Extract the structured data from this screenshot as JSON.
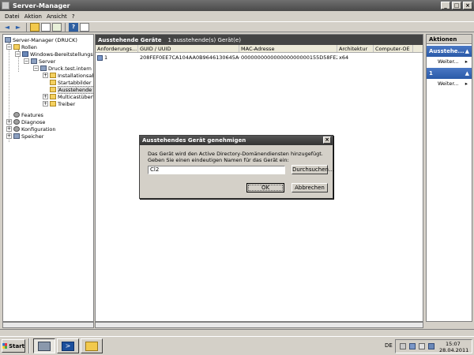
{
  "window": {
    "title": "Server-Manager"
  },
  "menu": [
    "Datei",
    "Aktion",
    "Ansicht",
    "?"
  ],
  "tree": {
    "root": "Server-Manager (DRUCK)",
    "rollen": "Rollen",
    "wds": "Windows-Bereitstellungsdie",
    "server": "Server",
    "druck": "Druck.test.intern",
    "installationsabb": "Installationsabb",
    "startabbilder": "Startabbilder",
    "ausstehende": "Ausstehende G",
    "multicast": "Multicastübertr",
    "treiber": "Treiber",
    "features": "Features",
    "diagnose": "Diagnose",
    "konfiguration": "Konfiguration",
    "speicher": "Speicher"
  },
  "center": {
    "header_title": "Ausstehende Geräte",
    "header_count": "1 ausstehende(s) Gerät(e)",
    "columns": [
      "Anforderungs...",
      "GUID / UUID",
      "MAC-Adresse",
      "Architektur",
      "Computer-OE"
    ],
    "rows": [
      {
        "id": "1",
        "guid": "208FEF0EE7CA104AA0B9646130645AC",
        "mac": "000000000000000000000155D58FE2A",
        "arch": "x64",
        "ou": ""
      }
    ]
  },
  "actions": {
    "title": "Aktionen",
    "section1": "Ausstehe...",
    "item1": "Weiter...",
    "section2": "1",
    "item2": "Weiter..."
  },
  "dialog": {
    "title": "Ausstehendes Gerät genehmigen",
    "message": "Das Gerät wird den Active Directory-Domänendiensten hinzugefügt. Geben Sie einen eindeutigen Namen für das Gerät ein:",
    "input_value": "Cl2",
    "browse_label": "Durchsuchen...",
    "ok_label": "OK",
    "cancel_label": "Abbrechen"
  },
  "taskbar": {
    "start_label": "Start",
    "language": "DE",
    "clock_time": "15:07",
    "clock_date": "28.04.2011"
  }
}
